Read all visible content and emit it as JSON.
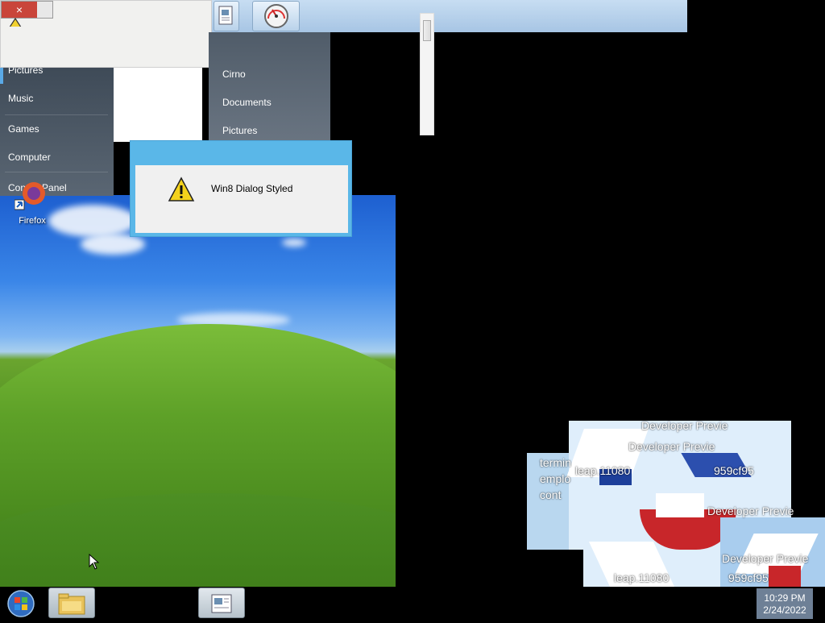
{
  "top_left_window": {
    "close_glyph": "×"
  },
  "start_menu_left": {
    "items": [
      "Pictures",
      "Music",
      "Games",
      "Computer",
      "Control Panel"
    ]
  },
  "start_menu_right": {
    "items": [
      "Cirno",
      "Documents",
      "Pictures"
    ]
  },
  "desktop": {
    "firefox_label": "Firefox"
  },
  "win8_dialog": {
    "message": "Win8 Dialog Styled"
  },
  "glitch_window": {
    "texts": [
      "Developer Previe",
      "Developer Previe",
      "termin",
      "leap.11080",
      "959cf95",
      "emplo",
      "cont",
      "Developer Previe",
      "Developer Previe",
      "leap.11080",
      "959cf95"
    ]
  },
  "taskbar": {
    "time": "10:29 PM",
    "date": "2/24/2022"
  },
  "icons": {
    "start": "windows-orb-icon",
    "explorer": "folder-icon",
    "document": "document-icon",
    "warning": "warning-icon",
    "firefox": "firefox-icon",
    "speedometer": "speedometer-icon"
  },
  "colors": {
    "accent": "#5ab7e8",
    "close_red": "#c9453a",
    "clock_bg": "#6e8096"
  }
}
